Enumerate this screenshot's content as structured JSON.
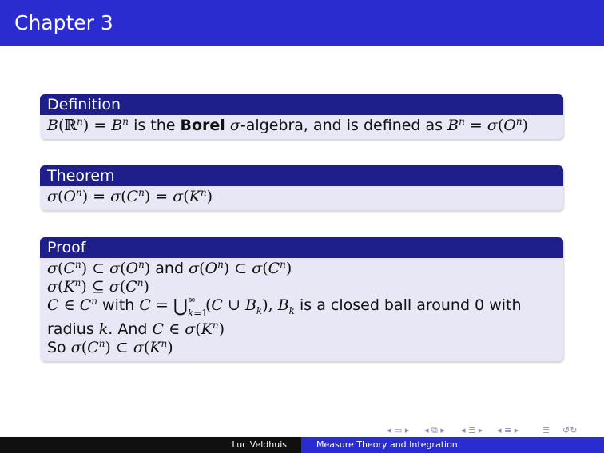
{
  "frame_title": "Chapter 3",
  "definition": {
    "title": "Definition",
    "text_is_the": " is the ",
    "bold_word": "Borel",
    "text_rest": "-algebra, and is defined as "
  },
  "theorem": {
    "title": "Theorem"
  },
  "proof": {
    "title": "Proof",
    "and_word": " and ",
    "with_word": " with ",
    "closed_ball_text": " is a closed ball around 0 with",
    "radius_text": "radius ",
    "and_text": ". And ",
    "so_word": "So "
  },
  "footer": {
    "author": "Luc Veldhuis",
    "title": "Measure Theory and Integration"
  },
  "nav_icon": "beamer-navigation-symbols"
}
